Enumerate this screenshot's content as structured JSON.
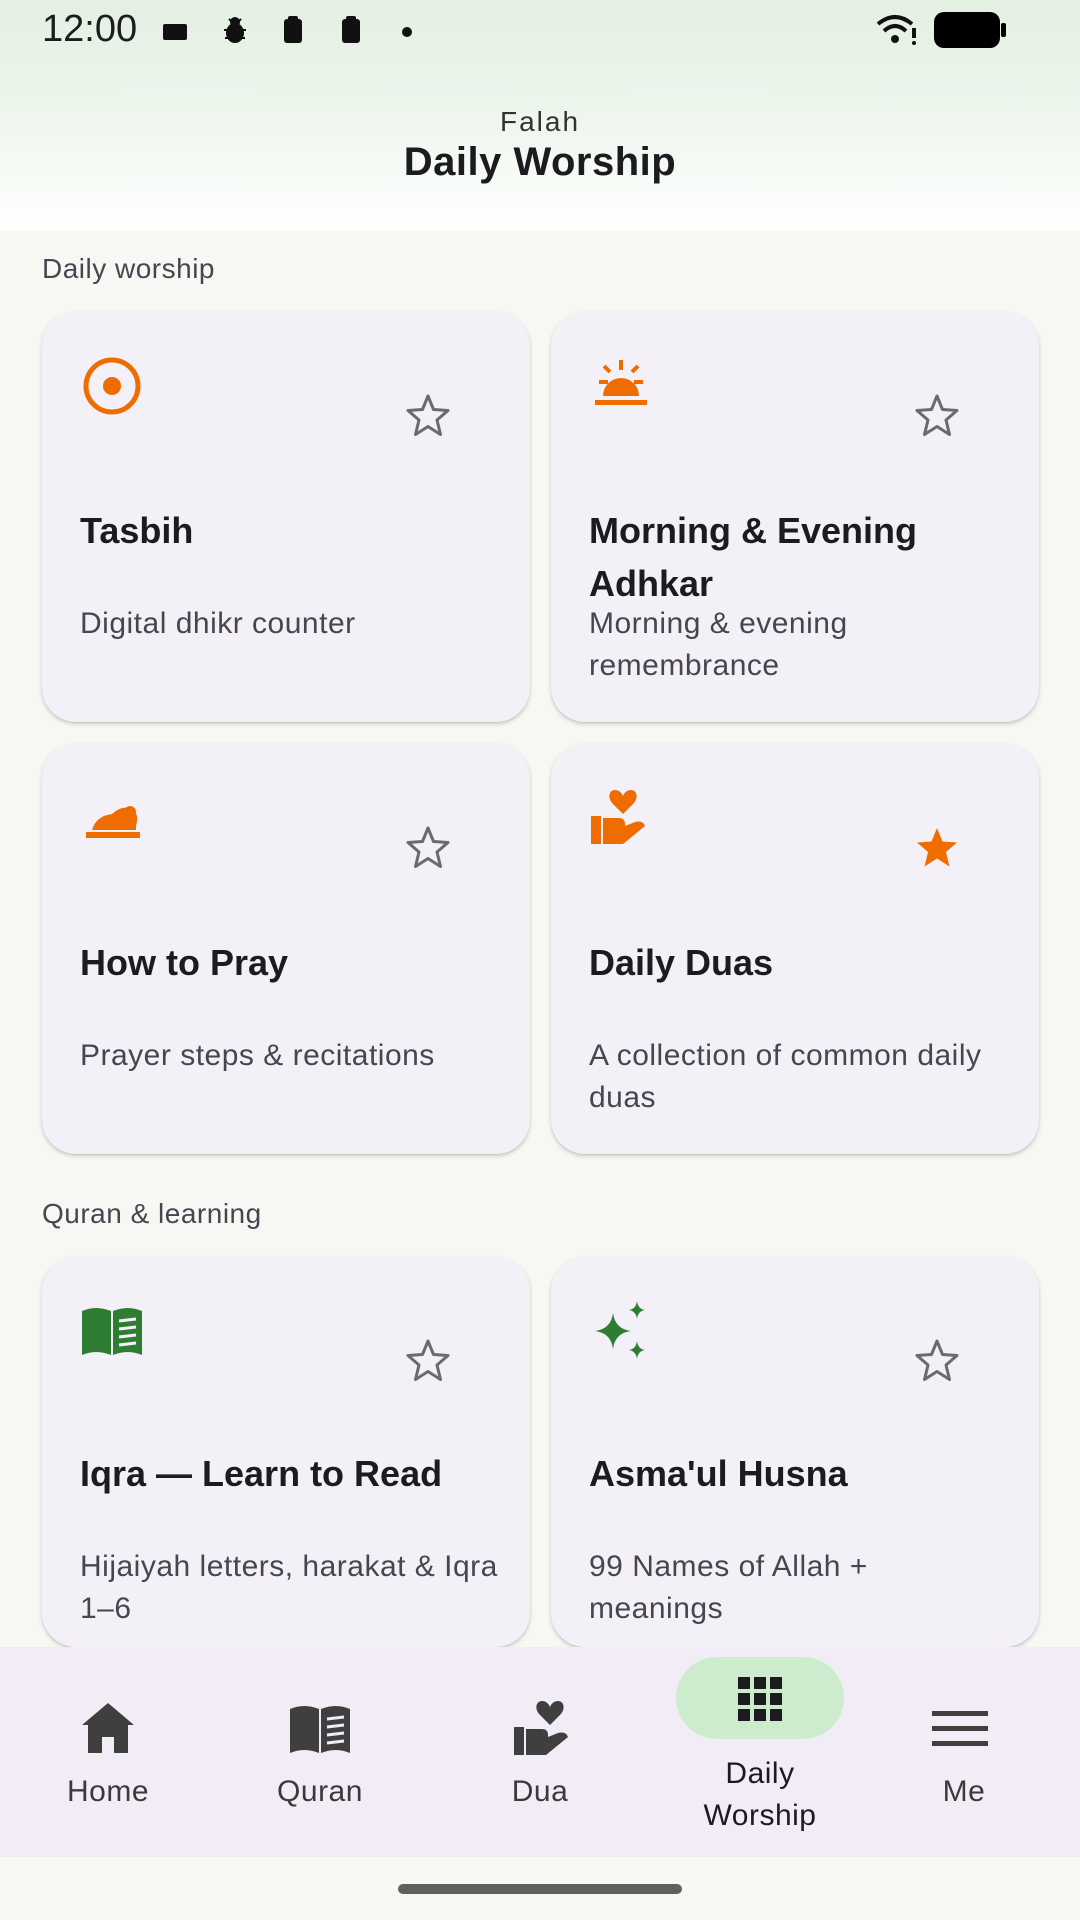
{
  "status_bar": {
    "time": "12:00",
    "icons": [
      "notification-icon",
      "bug-icon",
      "clipboard-icon",
      "clipboard-icon",
      "dot-icon",
      "wifi-icon",
      "battery-icon"
    ]
  },
  "header": {
    "app_name": "Falah",
    "title": "Daily Worship"
  },
  "sections": [
    {
      "label": "Daily worship",
      "cards": [
        {
          "title": "Tasbih",
          "subtitle": "Digital dhikr counter",
          "icon": "target-icon",
          "favorite": false
        },
        {
          "title": "Morning & Evening Adhkar",
          "subtitle": "Morning & evening remembrance",
          "icon": "sunrise-icon",
          "favorite": false
        },
        {
          "title": "How to Pray",
          "subtitle": "Prayer steps & recitations",
          "icon": "prostration-icon",
          "favorite": false
        },
        {
          "title": "Daily Duas",
          "subtitle": "A collection of common daily duas",
          "icon": "hand-heart-icon",
          "favorite": true
        }
      ]
    },
    {
      "label": "Quran & learning",
      "cards": [
        {
          "title": "Iqra — Learn to Read",
          "subtitle": "Hijaiyah letters, harakat & Iqra 1–6",
          "icon": "open-book-icon",
          "favorite": false
        },
        {
          "title": "Asma'ul Husna",
          "subtitle": "99 Names of Allah + meanings",
          "icon": "sparkles-icon",
          "favorite": false
        }
      ]
    }
  ],
  "bottom_nav": {
    "items": [
      {
        "label": "Home",
        "icon": "home-icon",
        "active": false
      },
      {
        "label": "Quran",
        "icon": "book-icon",
        "active": false
      },
      {
        "label": "Dua",
        "icon": "hand-heart-icon",
        "active": false
      },
      {
        "label": "Daily Worship",
        "icon": "grid-icon",
        "active": true
      },
      {
        "label": "Me",
        "icon": "menu-icon",
        "active": false
      }
    ]
  },
  "colors": {
    "accent_orange": "#ef6c00",
    "accent_green": "#2e7d32",
    "card_bg": "#f4f0f7",
    "nav_bg": "#f2ecf6",
    "active_pill": "#cdeccd"
  }
}
